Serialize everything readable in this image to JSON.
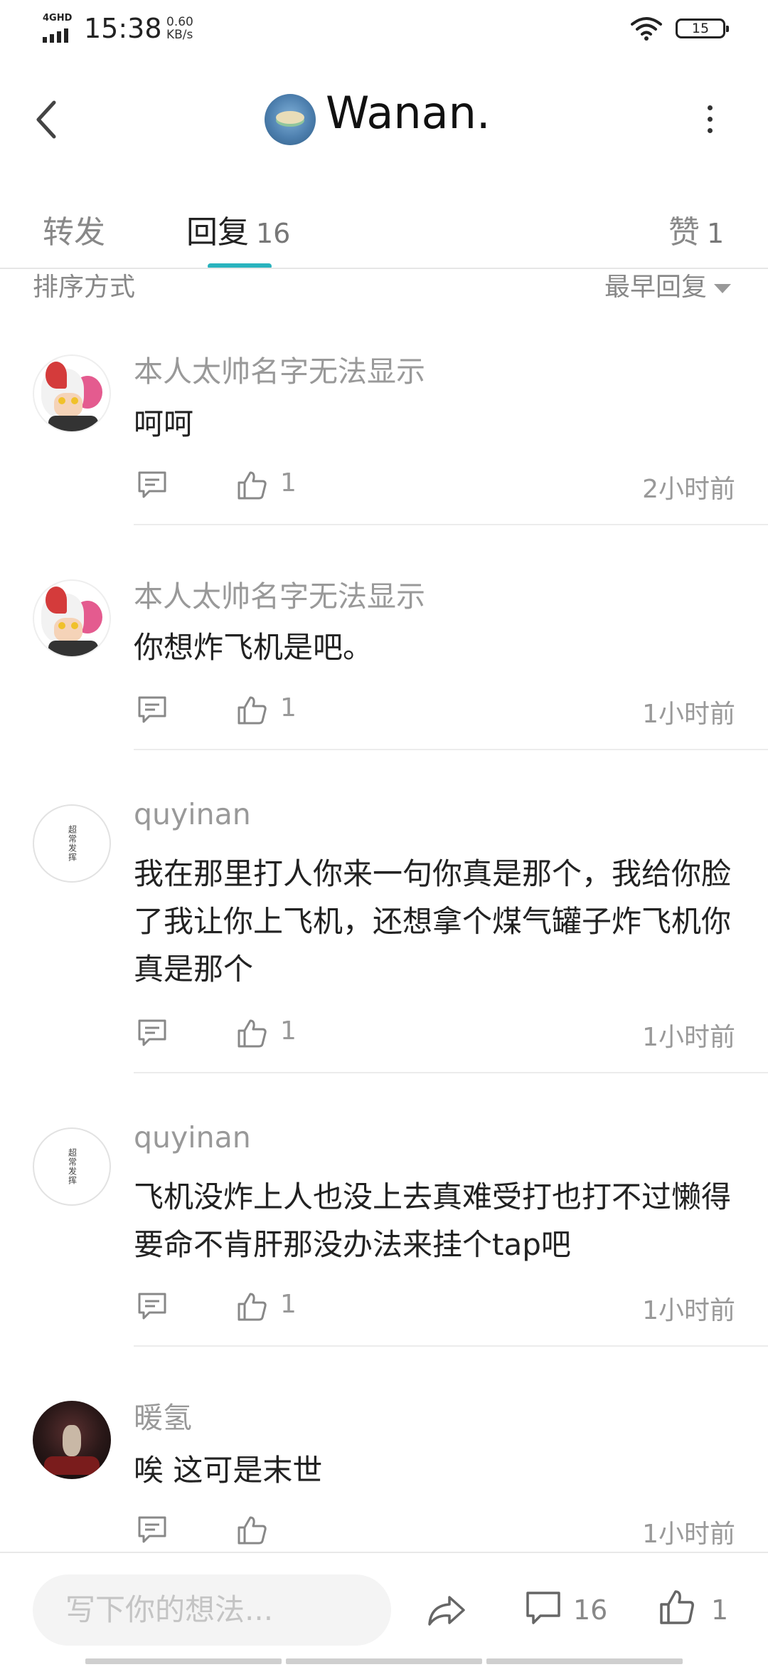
{
  "status_bar": {
    "network": "4GHD",
    "time": "15:38",
    "speed_value": "0.60",
    "speed_unit": "KB/s",
    "battery": "15"
  },
  "header": {
    "title": "Wanan."
  },
  "tabs": [
    {
      "label": "转发",
      "count": ""
    },
    {
      "label": "回复",
      "count": "16"
    },
    {
      "label": "赞",
      "count": "1"
    }
  ],
  "colors": {
    "accent": "#2ab3be",
    "text_primary": "#222222",
    "text_secondary": "#999999"
  },
  "sort": {
    "label": "排序方式",
    "value": "最早回复"
  },
  "comments": [
    {
      "user": "本人太帅名字无法显示",
      "text": "呵呵",
      "likes": "1",
      "time": "2小时前",
      "avatar": "anime-avatar"
    },
    {
      "user": "本人太帅名字无法显示",
      "text": "你想炸飞机是吧。",
      "likes": "1",
      "time": "1小时前",
      "avatar": "anime-avatar"
    },
    {
      "user": "quyinan",
      "text": "我在那里打人你来一句你真是那个，我给你脸了我让你上飞机，还想拿个煤气罐子炸飞机你真是那个",
      "likes": "1",
      "time": "1小时前",
      "avatar": "calligraphy-avatar",
      "avatar_text": "超常发挥"
    },
    {
      "user": "quyinan",
      "text": "飞机没炸上人也没上去真难受打也打不过懒得要命不肯肝那没办法来挂个tap吧",
      "likes": "1",
      "time": "1小时前",
      "avatar": "calligraphy-avatar",
      "avatar_text": "超常发挥"
    },
    {
      "user": "暖氢",
      "text": "唉 这可是末世",
      "likes": "",
      "time": "1小时前",
      "avatar": "dark-portrait-avatar"
    }
  ],
  "bottom_bar": {
    "input_placeholder": "写下你的想法...",
    "comment_count": "16",
    "like_count": "1"
  }
}
